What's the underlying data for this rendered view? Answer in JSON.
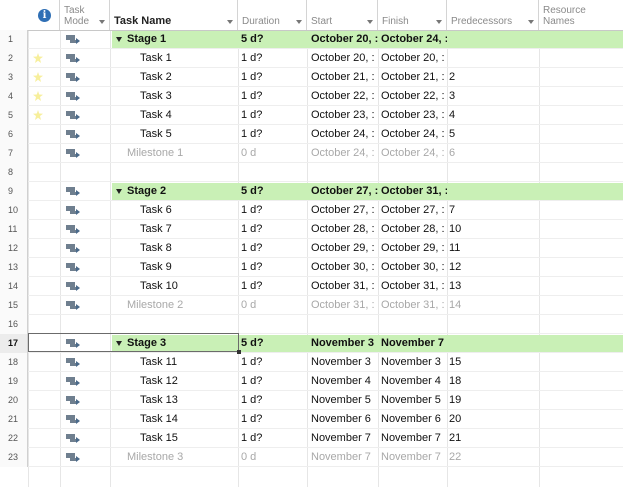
{
  "header": {
    "task_mode": "Task\nMode",
    "task_name": "Task Name",
    "duration": "Duration",
    "start": "Start",
    "finish": "Finish",
    "predecessors": "Predecessors",
    "resource_names": "Resource\nNames",
    "info_icon": "i"
  },
  "rows": [
    {
      "id": "1",
      "type": "summary",
      "name": "Stage 1",
      "dur": "5 d?",
      "start": "October 20, :",
      "finish": "October 24, :",
      "pred": "",
      "star": false
    },
    {
      "id": "2",
      "type": "task",
      "name": "Task 1",
      "dur": "1 d?",
      "start": "October 20, :",
      "finish": "October 20, :",
      "pred": "",
      "star": true
    },
    {
      "id": "3",
      "type": "task",
      "name": "Task 2",
      "dur": "1 d?",
      "start": "October 21, :",
      "finish": "October 21, :",
      "pred": "2",
      "star": true
    },
    {
      "id": "4",
      "type": "task",
      "name": "Task 3",
      "dur": "1 d?",
      "start": "October 22, :",
      "finish": "October 22, :",
      "pred": "3",
      "star": true
    },
    {
      "id": "5",
      "type": "task",
      "name": "Task 4",
      "dur": "1 d?",
      "start": "October 23, :",
      "finish": "October 23, :",
      "pred": "4",
      "star": true
    },
    {
      "id": "6",
      "type": "task",
      "name": "Task 5",
      "dur": "1 d?",
      "start": "October 24, :",
      "finish": "October 24, :",
      "pred": "5",
      "star": false
    },
    {
      "id": "7",
      "type": "milestone",
      "name": "Milestone 1",
      "dur": "0 d",
      "start": "October 24, :",
      "finish": "October 24, :",
      "pred": "6",
      "star": false
    },
    {
      "id": "8",
      "type": "empty"
    },
    {
      "id": "9",
      "type": "summary",
      "name": "Stage 2",
      "dur": "5 d?",
      "start": "October 27, :",
      "finish": "October 31, :",
      "pred": "",
      "star": false
    },
    {
      "id": "10",
      "type": "task",
      "name": "Task 6",
      "dur": "1 d?",
      "start": "October 27, :",
      "finish": "October 27, :",
      "pred": "7",
      "star": false
    },
    {
      "id": "11",
      "type": "task",
      "name": "Task 7",
      "dur": "1 d?",
      "start": "October 28, :",
      "finish": "October 28, :",
      "pred": "10",
      "star": false
    },
    {
      "id": "12",
      "type": "task",
      "name": "Task 8",
      "dur": "1 d?",
      "start": "October 29, :",
      "finish": "October 29, :",
      "pred": "11",
      "star": false
    },
    {
      "id": "13",
      "type": "task",
      "name": "Task 9",
      "dur": "1 d?",
      "start": "October 30, :",
      "finish": "October 30, :",
      "pred": "12",
      "star": false
    },
    {
      "id": "14",
      "type": "task",
      "name": "Task 10",
      "dur": "1 d?",
      "start": "October 31, :",
      "finish": "October 31, :",
      "pred": "13",
      "star": false
    },
    {
      "id": "15",
      "type": "milestone",
      "name": "Milestone 2",
      "dur": "0 d",
      "start": "October 31, :",
      "finish": "October 31, :",
      "pred": "14",
      "star": false
    },
    {
      "id": "16",
      "type": "empty"
    },
    {
      "id": "17",
      "type": "summary",
      "name": "Stage 3",
      "dur": "5 d?",
      "start": "November 3",
      "finish": "November 7",
      "pred": "",
      "star": false,
      "selected": true
    },
    {
      "id": "18",
      "type": "task",
      "name": "Task 11",
      "dur": "1 d?",
      "start": "November 3",
      "finish": "November 3",
      "pred": "15",
      "star": false
    },
    {
      "id": "19",
      "type": "task",
      "name": "Task 12",
      "dur": "1 d?",
      "start": "November 4",
      "finish": "November 4",
      "pred": "18",
      "star": false
    },
    {
      "id": "20",
      "type": "task",
      "name": "Task 13",
      "dur": "1 d?",
      "start": "November 5",
      "finish": "November 5",
      "pred": "19",
      "star": false
    },
    {
      "id": "21",
      "type": "task",
      "name": "Task 14",
      "dur": "1 d?",
      "start": "November 6",
      "finish": "November 6",
      "pred": "20",
      "star": false
    },
    {
      "id": "22",
      "type": "task",
      "name": "Task 15",
      "dur": "1 d?",
      "start": "November 7",
      "finish": "November 7",
      "pred": "21",
      "star": false
    },
    {
      "id": "23",
      "type": "milestone",
      "name": "Milestone 3",
      "dur": "0 d",
      "start": "November 7",
      "finish": "November 7",
      "pred": "22",
      "star": false
    }
  ],
  "colors": {
    "summary_band": "#c9f0b6",
    "milestone_text": "#a8a8a8",
    "info_icon": "#2f6fb5"
  }
}
